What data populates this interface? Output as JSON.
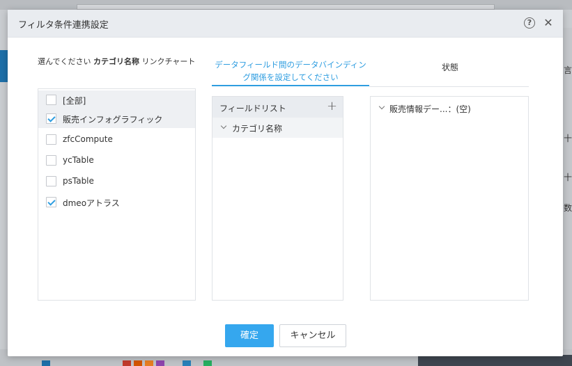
{
  "background": {
    "right_edge_labels": [
      "言",
      "十",
      "十",
      "数"
    ]
  },
  "dialog": {
    "title": "フィルタ条件連携設定",
    "help_glyph": "?",
    "close_glyph": "✕"
  },
  "left_panel": {
    "label_prefix": "選んでください ",
    "label_bold": "カテゴリ名称",
    "label_suffix": " リンクチャート",
    "items": [
      {
        "label": "[全部]",
        "checked": false
      },
      {
        "label": "販売インフォグラフィック",
        "checked": true
      },
      {
        "label": "zfcCompute",
        "checked": false
      },
      {
        "label": "ycTable",
        "checked": false
      },
      {
        "label": "psTable",
        "checked": false
      },
      {
        "label": "dmeoアトラス",
        "checked": true
      }
    ]
  },
  "tabs": {
    "binding_label": "データフィールド間のデータバインディング関係を設定してください",
    "state_label": "状態"
  },
  "field_panel": {
    "header": "フィールドリスト",
    "add_glyph": "+",
    "items": [
      "カテゴリ名称"
    ]
  },
  "state_panel": {
    "items": [
      "販売情報デー...：(空)"
    ]
  },
  "buttons": {
    "confirm": "確定",
    "cancel": "キャンセル"
  },
  "colors": {
    "accent": "#2e9de0",
    "primary_button": "#35a7ee",
    "header_bg": "#e9ecf0"
  }
}
